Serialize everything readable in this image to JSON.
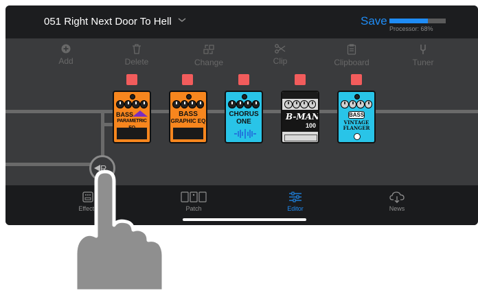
{
  "header": {
    "patch_name": "051 Right Next Door To Hell",
    "save_label": "Save",
    "processor_label": "Processor: 68%",
    "processor_usage": 0.68
  },
  "toolbar": [
    {
      "label": "Add",
      "icon": "plus-circle-icon"
    },
    {
      "label": "Delete",
      "icon": "trash-icon"
    },
    {
      "label": "Change",
      "icon": "swap-icon"
    },
    {
      "label": "Clip",
      "icon": "scissors-icon"
    },
    {
      "label": "Clipboard",
      "icon": "clipboard-icon"
    },
    {
      "label": "Tuner",
      "icon": "tuning-fork-icon"
    }
  ],
  "pedals": [
    {
      "name_line1": "BASS",
      "name_line2": "PARAMETRIC EQ",
      "color": "#f7861e"
    },
    {
      "name_line1": "BASS",
      "name_line2": "GRAPHIC EQ",
      "color": "#f7861e"
    },
    {
      "name_line1": "CHORUS",
      "name_line2": "ONE",
      "color": "#29c4e8"
    },
    {
      "name_line1": "B-MAN",
      "name_line2": "100",
      "color": "#d9d9d9"
    },
    {
      "name_line1": "BASS",
      "name_line2": "VINTAGE FLANGER",
      "color": "#29c4e8"
    }
  ],
  "routing_label": "R",
  "bottom_nav": [
    {
      "label": "Effects",
      "icon": "effects-icon",
      "active": false
    },
    {
      "label": "Patch",
      "icon": "patch-icon",
      "active": false
    },
    {
      "label": "Editor",
      "icon": "sliders-icon",
      "active": true
    },
    {
      "label": "News",
      "icon": "cloud-download-icon",
      "active": false
    }
  ],
  "colors": {
    "accent": "#1f8cf5",
    "selection": "#f25c5c",
    "background": "#3a3b3d",
    "bar": "#1c1d1f"
  }
}
